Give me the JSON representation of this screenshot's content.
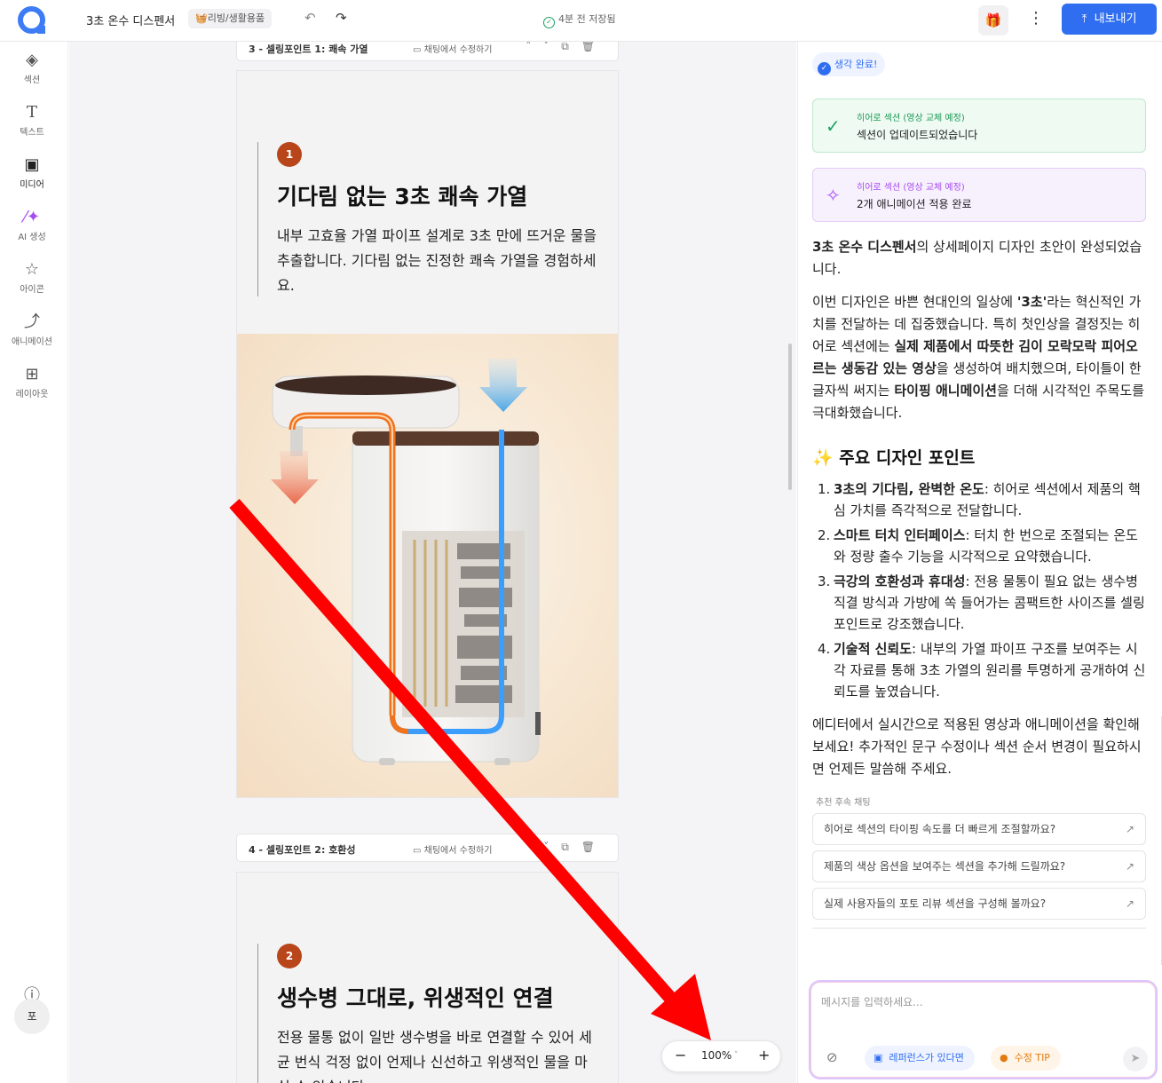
{
  "topbar": {
    "doc_title": "3초 온수 디스펜서",
    "category": "🧺리빙/생활용품",
    "save_status": "4분 전 저장됨",
    "export_label": "내보내기"
  },
  "rail": {
    "items": [
      {
        "label": "섹션",
        "icon": "layers-icon"
      },
      {
        "label": "텍스트",
        "icon": "text-icon"
      },
      {
        "label": "미디어",
        "icon": "image-icon"
      },
      {
        "label": "AI 생성",
        "icon": "magic-wand-icon"
      },
      {
        "label": "아이콘",
        "icon": "star-icon"
      },
      {
        "label": "애니메이션",
        "icon": "curve-icon"
      },
      {
        "label": "레이아웃",
        "icon": "grid-icon"
      }
    ],
    "help_label": "문의하기",
    "avatar": "포"
  },
  "canvas": {
    "section3": {
      "title": "3 - 셀링포인트 1: 쾌속 가열",
      "edit_label": "채팅에서 수정하기",
      "badge": "1",
      "heading": "기다림 없는 3초 쾌속 가열",
      "body": "내부 고효율 가열 파이프 설계로 3초 만에 뜨거운 물을 추출합니다. 기다림 없는 진정한 쾌속 가열을 경험하세요."
    },
    "section4": {
      "title": "4 - 셀링포인트 2: 호환성",
      "edit_label": "채팅에서 수정하기",
      "badge": "2",
      "heading": "생수병 그대로, 위생적인 연결",
      "body": "전용 물통 없이 일반 생수병을 바로 연결할 수 있어 세균 번식 걱정 없이 언제나 신선하고 위생적인 물을 마실 수 있습니다."
    },
    "zoom": "100%"
  },
  "chat": {
    "thinking_label": "생각 완료!",
    "status_cards": [
      {
        "kicker": "히어로 섹션 (영상 교체 예정)",
        "text": "섹션이 업데이트되었습니다"
      },
      {
        "kicker": "히어로 섹션 (영상 교체 예정)",
        "text": "2개 애니메이션 적용 완료"
      }
    ],
    "p1": {
      "b1": "3초 온수 디스펜서",
      "t1": "의 상세페이지 디자인 초안이 완성되었습니다."
    },
    "p2": {
      "t1": "이번 디자인은 바쁜 현대인의 일상에 ",
      "b1": "'3초'",
      "t2": "라는 혁신적인 가치를 전달하는 데 집중했습니다. 특히 첫인상을 결정짓는 히어로 섹션에는 ",
      "b2": "실제 제품에서 따뜻한 김이 모락모락 피어오르는 생동감 있는 영상",
      "t3": "을 생성하여 배치했으며, 타이틀이 한 글자씩 써지는 ",
      "b3": "타이핑 애니메이션",
      "t4": "을 더해 시각적인 주목도를 극대화했습니다."
    },
    "points_title": "✨ 주요 디자인 포인트",
    "points": [
      {
        "n": "1.",
        "b": "3초의 기다림, 완벽한 온도",
        "t": ": 히어로 섹션에서 제품의 핵심 가치를 즉각적으로 전달합니다."
      },
      {
        "n": "2.",
        "b": "스마트 터치 인터페이스",
        "t": ": 터치 한 번으로 조절되는 온도와 정량 출수 기능을 시각적으로 요약했습니다."
      },
      {
        "n": "3.",
        "b": "극강의 호환성과 휴대성",
        "t": ": 전용 물통이 필요 없는 생수병 직결 방식과 가방에 쏙 들어가는 콤팩트한 사이즈를 셀링포인트로 강조했습니다."
      },
      {
        "n": "4.",
        "b": "기술적 신뢰도",
        "t": ": 내부의 가열 파이프 구조를 보여주는 시각 자료를 통해 3초 가열의 원리를 투명하게 공개하여 신뢰도를 높였습니다."
      }
    ],
    "p3": "에디터에서 실시간으로 적용된 영상과 애니메이션을 확인해 보세요! 추가적인 문구 수정이나 섹션 순서 변경이 필요하시면 언제든 말씀해 주세요.",
    "followup_label": "추천 후속 채팅",
    "followups": [
      "히어로 섹션의 타이핑 속도를 더 빠르게 조절할까요?",
      "제품의 색상 옵션을 보여주는 섹션을 추가해 드릴까요?",
      "실제 사용자들의 포토 리뷰 섹션을 구성해 볼까요?"
    ],
    "input_placeholder": "메시지를 입력하세요...",
    "chip_reference": "레퍼런스가 있다면",
    "chip_tip": "수정 TIP"
  },
  "colors": {
    "accent": "#2f6ef0",
    "badge": "#b8461a",
    "success": "#1aa260",
    "ai": "#a64df0",
    "arrow": "#ff0000"
  }
}
